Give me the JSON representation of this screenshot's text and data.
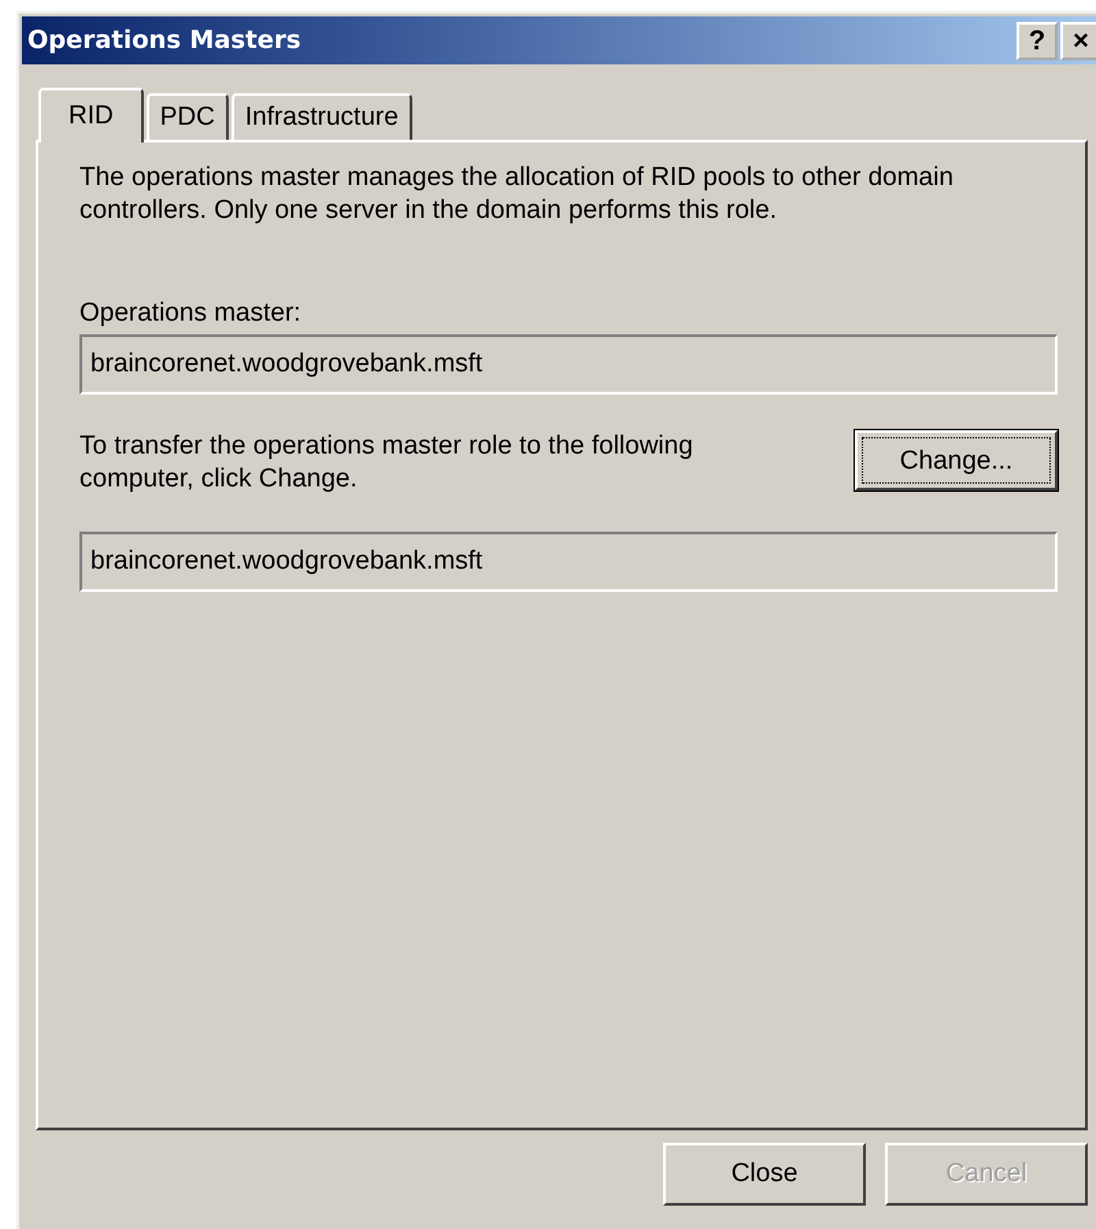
{
  "window": {
    "title": "Operations Masters",
    "help_button": "?",
    "close_button": "×"
  },
  "tabs": [
    {
      "label": "RID",
      "selected": true
    },
    {
      "label": "PDC",
      "selected": false
    },
    {
      "label": "Infrastructure",
      "selected": false
    }
  ],
  "description": "The operations master manages the allocation of RID pools to other domain controllers. Only one server in the domain performs this role.",
  "operations_master": {
    "label": "Operations master:",
    "value": "braincorenet.woodgrovebank.msft"
  },
  "transfer": {
    "text": "To transfer the operations master role to the following computer, click Change.",
    "button": "Change...",
    "value": "braincorenet.woodgrovebank.msft"
  },
  "buttons": [
    {
      "label": "Close",
      "disabled": false
    },
    {
      "label": "Cancel",
      "disabled": true
    }
  ]
}
